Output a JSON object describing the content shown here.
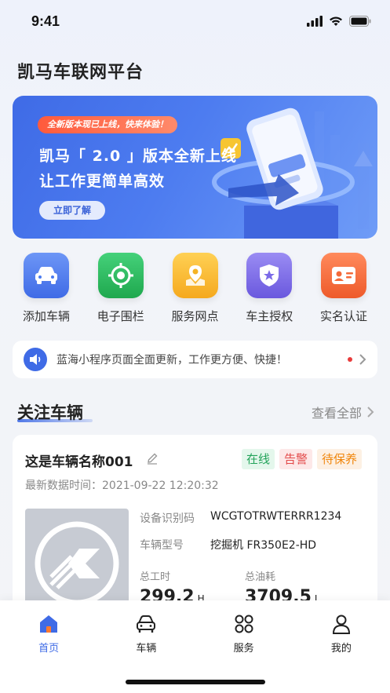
{
  "status_bar": {
    "time": "9:41"
  },
  "app": {
    "title": "凯马车联网平台"
  },
  "banner": {
    "pill": "全新版本现已上线，快来体验！",
    "headline1": "凯马「 2.0 」版本全新上线",
    "headline2": "让工作更简单高效",
    "button": "立即了解"
  },
  "quick_actions": [
    {
      "label": "添加车辆",
      "icon": "car-icon",
      "color": "#4a7bf0"
    },
    {
      "label": "电子围栏",
      "icon": "target-icon",
      "color": "#23b857"
    },
    {
      "label": "服务网点",
      "icon": "location-icon",
      "color": "#f5b324"
    },
    {
      "label": "车主授权",
      "icon": "shield-star-icon",
      "color": "#7b6ae8"
    },
    {
      "label": "实名认证",
      "icon": "id-card-icon",
      "color": "#f46a3a"
    }
  ],
  "notice": {
    "text": "蓝海小程序页面全面更新，工作更方便、快捷！",
    "icon": "speaker-icon"
  },
  "section": {
    "title": "关注车辆",
    "more": "查看全部"
  },
  "vehicle": {
    "name": "这是车辆名称001",
    "tags": [
      "在线",
      "告警",
      "待保养"
    ],
    "time_label": "最新数据时间：",
    "time_value": "2021-09-22 12:20:32",
    "device_id_label": "设备识别码",
    "device_id_value": "WCGTOTRWTERRR1234",
    "model_label": "车辆型号",
    "model_value": "挖掘机 FR350E2-HD",
    "total_hours_label": "总工时",
    "total_hours_value": "299.2",
    "total_hours_unit": "H",
    "total_fuel_label": "总油耗",
    "total_fuel_value": "3709.5",
    "total_fuel_unit": "L"
  },
  "tabbar": [
    {
      "label": "首页",
      "icon": "home-icon",
      "active": true
    },
    {
      "label": "车辆",
      "icon": "car-icon",
      "active": false
    },
    {
      "label": "服务",
      "icon": "grid-icon",
      "active": false
    },
    {
      "label": "我的",
      "icon": "user-icon",
      "active": false
    }
  ],
  "colors": {
    "primary": "#3f6be6",
    "alert": "#e83b3b"
  }
}
